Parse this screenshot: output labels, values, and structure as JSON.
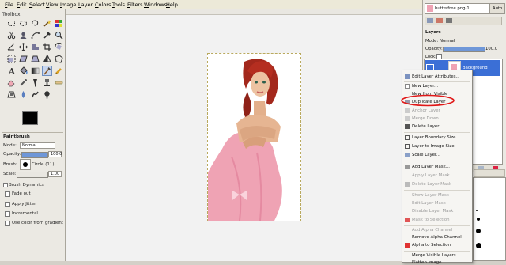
{
  "menu": [
    "File",
    "Edit",
    "Select",
    "View",
    "Image",
    "Layer",
    "Colors",
    "Tools",
    "Filters",
    "Windows",
    "Help"
  ],
  "toolbox": {
    "title": "Toolbox",
    "tool_options": {
      "title": "Paintbrush",
      "mode_label": "Mode:",
      "mode_value": "Normal",
      "opacity_label": "Opacity:",
      "opacity_value": "100.0",
      "brush_label": "Brush:",
      "brush_value": "Circle (11)",
      "scale_label": "Scale:",
      "scale_value": "1.00",
      "checkbox_dynamics": "Brush Dynamics",
      "checkbox_fade": "Fade out",
      "checkbox_jitter": "Apply Jitter",
      "checkbox_incremental": "Incremental",
      "checkbox_gradient": "Use color from gradient"
    },
    "fg_color": "#000000",
    "bg_color": "#ffffff"
  },
  "dock": {
    "image_selector": "butterfree.png-1",
    "auto_label": "Auto",
    "layers_title": "Layers",
    "mode_label": "Mode:",
    "mode_value": "Normal",
    "opacity_label": "Opacity:",
    "opacity_value": "100.0",
    "lock_label": "Lock:",
    "layer_name": "Background"
  },
  "context_menu": {
    "items": [
      {
        "label": "Edit Layer Attributes...",
        "enabled": true
      },
      {
        "label": "New Layer...",
        "enabled": true
      },
      {
        "label": "New from Visible",
        "enabled": true
      },
      {
        "label": "Duplicate Layer",
        "enabled": true,
        "highlighted": true
      },
      {
        "label": "Anchor Layer",
        "enabled": false
      },
      {
        "label": "Merge Down",
        "enabled": false
      },
      {
        "label": "Delete Layer",
        "enabled": true
      },
      {
        "label": "Layer Boundary Size...",
        "enabled": true
      },
      {
        "label": "Layer to Image Size",
        "enabled": true
      },
      {
        "label": "Scale Layer...",
        "enabled": true
      },
      {
        "label": "Add Layer Mask...",
        "enabled": true
      },
      {
        "label": "Apply Layer Mask",
        "enabled": false
      },
      {
        "label": "Delete Layer Mask",
        "enabled": false
      },
      {
        "label": "Show Layer Mask",
        "enabled": false
      },
      {
        "label": "Edit Layer Mask",
        "enabled": false
      },
      {
        "label": "Disable Layer Mask",
        "enabled": false
      },
      {
        "label": "Mask to Selection",
        "enabled": false
      },
      {
        "label": "Add Alpha Channel",
        "enabled": false
      },
      {
        "label": "Remove Alpha Channel",
        "enabled": true
      },
      {
        "label": "Alpha to Selection",
        "enabled": true
      },
      {
        "label": "Merge Visible Layers...",
        "enabled": true
      },
      {
        "label": "Flatten Image",
        "enabled": true
      }
    ]
  },
  "colors": {
    "highlight_ring": "#e01818",
    "layer_selected": "#3b6fd6"
  }
}
